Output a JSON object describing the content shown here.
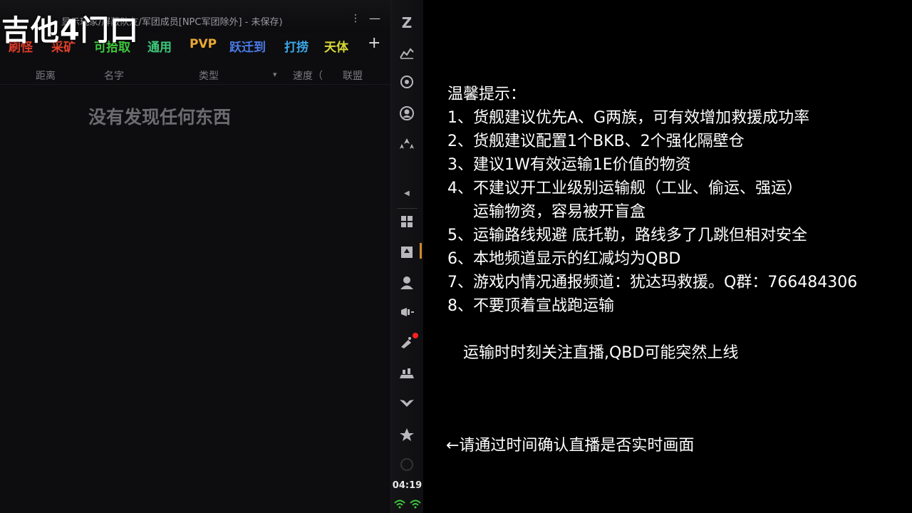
{
  "watermark": "吉他4门口",
  "overview": {
    "title": "显示玩家/屏蔽队友/军团成员[NPC军团除外] - 未保存)",
    "menu_icon": "⋮",
    "minimize_icon": "—",
    "tabs": [
      {
        "label": "刷怪",
        "color": "#e03a2a"
      },
      {
        "label": "采矿",
        "color": "#e0402a"
      },
      {
        "label": "可拾取",
        "color": "#3cc83c"
      },
      {
        "label": "通用",
        "color": "#3cc87a"
      },
      {
        "label": "PVP",
        "color": "#e8a834"
      },
      {
        "label": "跃迁到",
        "color": "#4a7ae8"
      },
      {
        "label": "打捞",
        "color": "#3aa8e8"
      },
      {
        "label": "天体",
        "color": "#d8d83a"
      }
    ],
    "add_tab": "+",
    "columns": [
      "距离",
      "名字",
      "类型",
      "速度（",
      "联盟"
    ],
    "sort_icon": "▾",
    "empty_message": "没有发现任何东西"
  },
  "neocom": {
    "clock": "04:19",
    "icons": [
      "eve-logo-icon",
      "chart-icon",
      "skills-icon",
      "character-icon",
      "fleet-icon",
      "collapse-arrow-icon",
      "inventory-icon",
      "hangar-icon",
      "people-icon",
      "broadcast-icon",
      "notification-icon",
      "industry-icon",
      "wings-icon",
      "corp-icon",
      "power-icon"
    ]
  },
  "notice": {
    "heading": "温馨提示：",
    "lines": [
      "1、货舰建议优先A、G两族，可有效增加救援成功率",
      "2、货舰建议配置1个BKB、2个强化隔壁仓",
      "3、建议1W有效运输1E价值的物资",
      "4、不建议开工业级别运输舰（工业、偷运、强运）",
      "运输物资，容易被开盲盒",
      "5、运输路线规避 底托勒，路线多了几跳但相对安全",
      "6、本地频道显示的红减均为QBD",
      "7、游戏内情况通报频道：犹达玛救援。Q群：766484306",
      "8、不要顶着宣战跑运输"
    ],
    "tip_live": "运输时时刻关注直播,QBD可能突然上线",
    "tip_time": "←请通过时间确认直播是否实时画面"
  }
}
